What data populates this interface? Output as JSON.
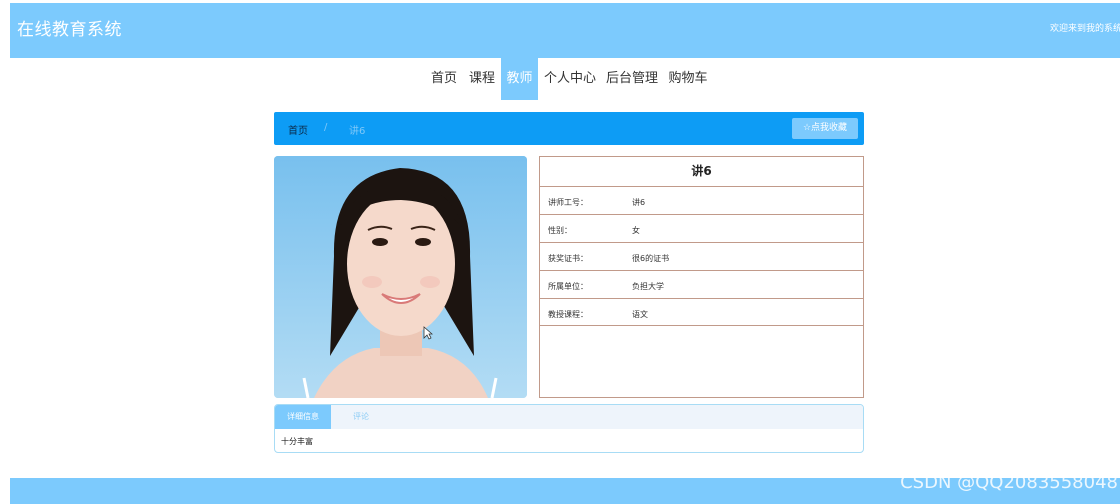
{
  "header": {
    "title": "在线教育系统",
    "welcome": "欢迎来到我的系统"
  },
  "nav": {
    "items": [
      {
        "label": "首页"
      },
      {
        "label": "课程"
      },
      {
        "label": "教师"
      },
      {
        "label": "个人中心"
      },
      {
        "label": "后台管理"
      },
      {
        "label": "购物车"
      }
    ],
    "active": "教师"
  },
  "breadcrumb": {
    "home": "首页",
    "separator": "/",
    "current": "讲6",
    "favorite_label": "☆点我收藏"
  },
  "teacher": {
    "name": "讲6",
    "fields": [
      {
        "label": "讲师工号：",
        "value": "讲6"
      },
      {
        "label": "性别：",
        "value": "女"
      },
      {
        "label": "获奖证书：",
        "value": "很6的证书"
      },
      {
        "label": "所属单位：",
        "value": "负担大学"
      },
      {
        "label": "教授课程：",
        "value": "语文"
      }
    ]
  },
  "tabs": {
    "items": [
      {
        "label": "详细信息"
      },
      {
        "label": "评论"
      }
    ],
    "content": "十分丰富"
  },
  "watermark": "CSDN @QQ2083558048",
  "colors": {
    "header": "#7ccafd",
    "breadcrumb": "#0d9cf5",
    "border": "#c19a8a"
  }
}
